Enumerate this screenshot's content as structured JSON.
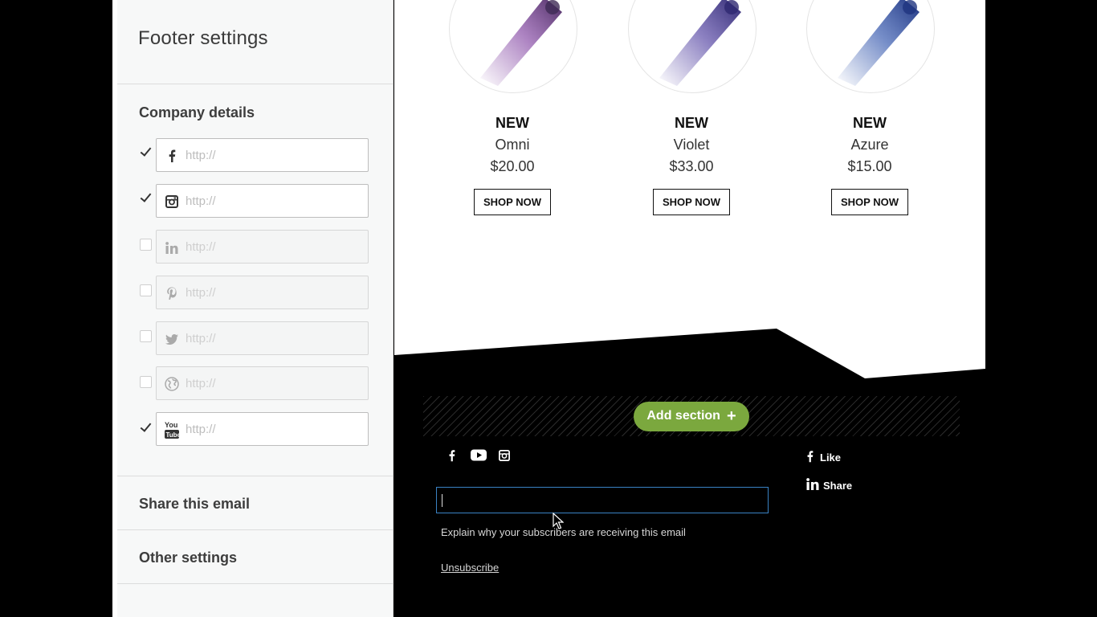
{
  "sidebar": {
    "title": "Footer settings",
    "company_details": {
      "heading": "Company details",
      "links": [
        {
          "network": "facebook",
          "icon": "facebook-icon",
          "checked": true,
          "placeholder": "http://"
        },
        {
          "network": "instagram",
          "icon": "instagram-icon",
          "checked": true,
          "placeholder": "http://"
        },
        {
          "network": "linkedin",
          "icon": "linkedin-icon",
          "checked": false,
          "placeholder": "http://"
        },
        {
          "network": "pinterest",
          "icon": "pinterest-icon",
          "checked": false,
          "placeholder": "http://"
        },
        {
          "network": "twitter",
          "icon": "twitter-icon",
          "checked": false,
          "placeholder": "http://"
        },
        {
          "network": "website",
          "icon": "globe-icon",
          "checked": false,
          "placeholder": "http://"
        },
        {
          "network": "youtube",
          "icon": "youtube-icon",
          "checked": true,
          "placeholder": "http://"
        }
      ]
    },
    "share_heading": "Share this email",
    "other_heading": "Other settings"
  },
  "products": [
    {
      "badge": "NEW",
      "name": "Omni",
      "price": "$20.00",
      "button": "SHOP NOW",
      "color": "#8a4fa8"
    },
    {
      "badge": "NEW",
      "name": "Violet",
      "price": "$33.00",
      "button": "SHOP NOW",
      "color": "#5a4aa6"
    },
    {
      "badge": "NEW",
      "name": "Azure",
      "price": "$15.00",
      "button": "SHOP NOW",
      "color": "#3a5cb0"
    }
  ],
  "add_section": {
    "label": "Add section",
    "color": "#7ba83e"
  },
  "footer": {
    "social_icons": [
      "facebook-icon",
      "youtube-icon",
      "instagram-icon"
    ],
    "like_label": "Like",
    "share_label": "Share",
    "input_value": "",
    "explain_text": "Explain why your subscribers are receiving this email",
    "unsubscribe": "Unsubscribe"
  }
}
